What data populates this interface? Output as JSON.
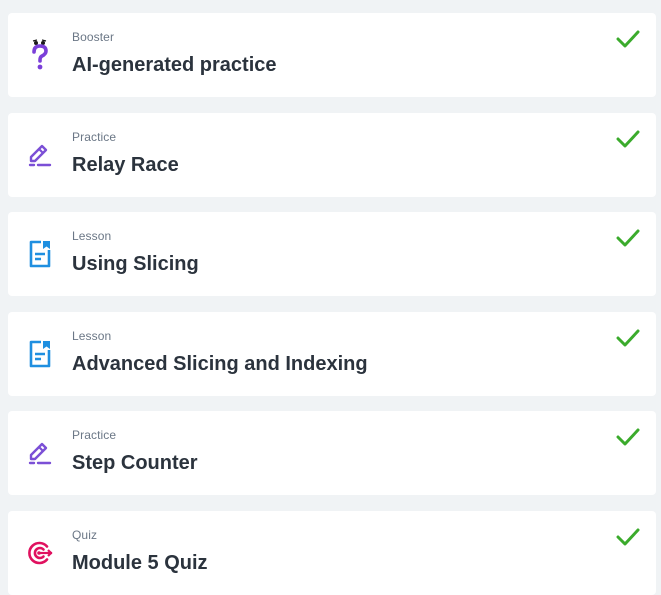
{
  "items": [
    {
      "type": "Booster",
      "title": "AI-generated practice",
      "icon": "question-bot-icon",
      "completed": true
    },
    {
      "type": "Practice",
      "title": "Relay Race",
      "icon": "pencil-icon",
      "completed": true
    },
    {
      "type": "Lesson",
      "title": "Using Slicing",
      "icon": "lesson-doc-icon",
      "completed": true
    },
    {
      "type": "Lesson",
      "title": "Advanced Slicing and Indexing",
      "icon": "lesson-doc-icon",
      "completed": true
    },
    {
      "type": "Practice",
      "title": "Step Counter",
      "icon": "pencil-icon",
      "completed": true
    },
    {
      "type": "Quiz",
      "title": "Module 5 Quiz",
      "icon": "target-icon",
      "completed": true
    }
  ],
  "colors": {
    "booster": "#7b3fd9",
    "practice": "#7b4fd6",
    "lesson": "#1f8fe0",
    "quiz": "#e0115f",
    "check": "#3bab2c",
    "background": "#f0f3f5"
  }
}
